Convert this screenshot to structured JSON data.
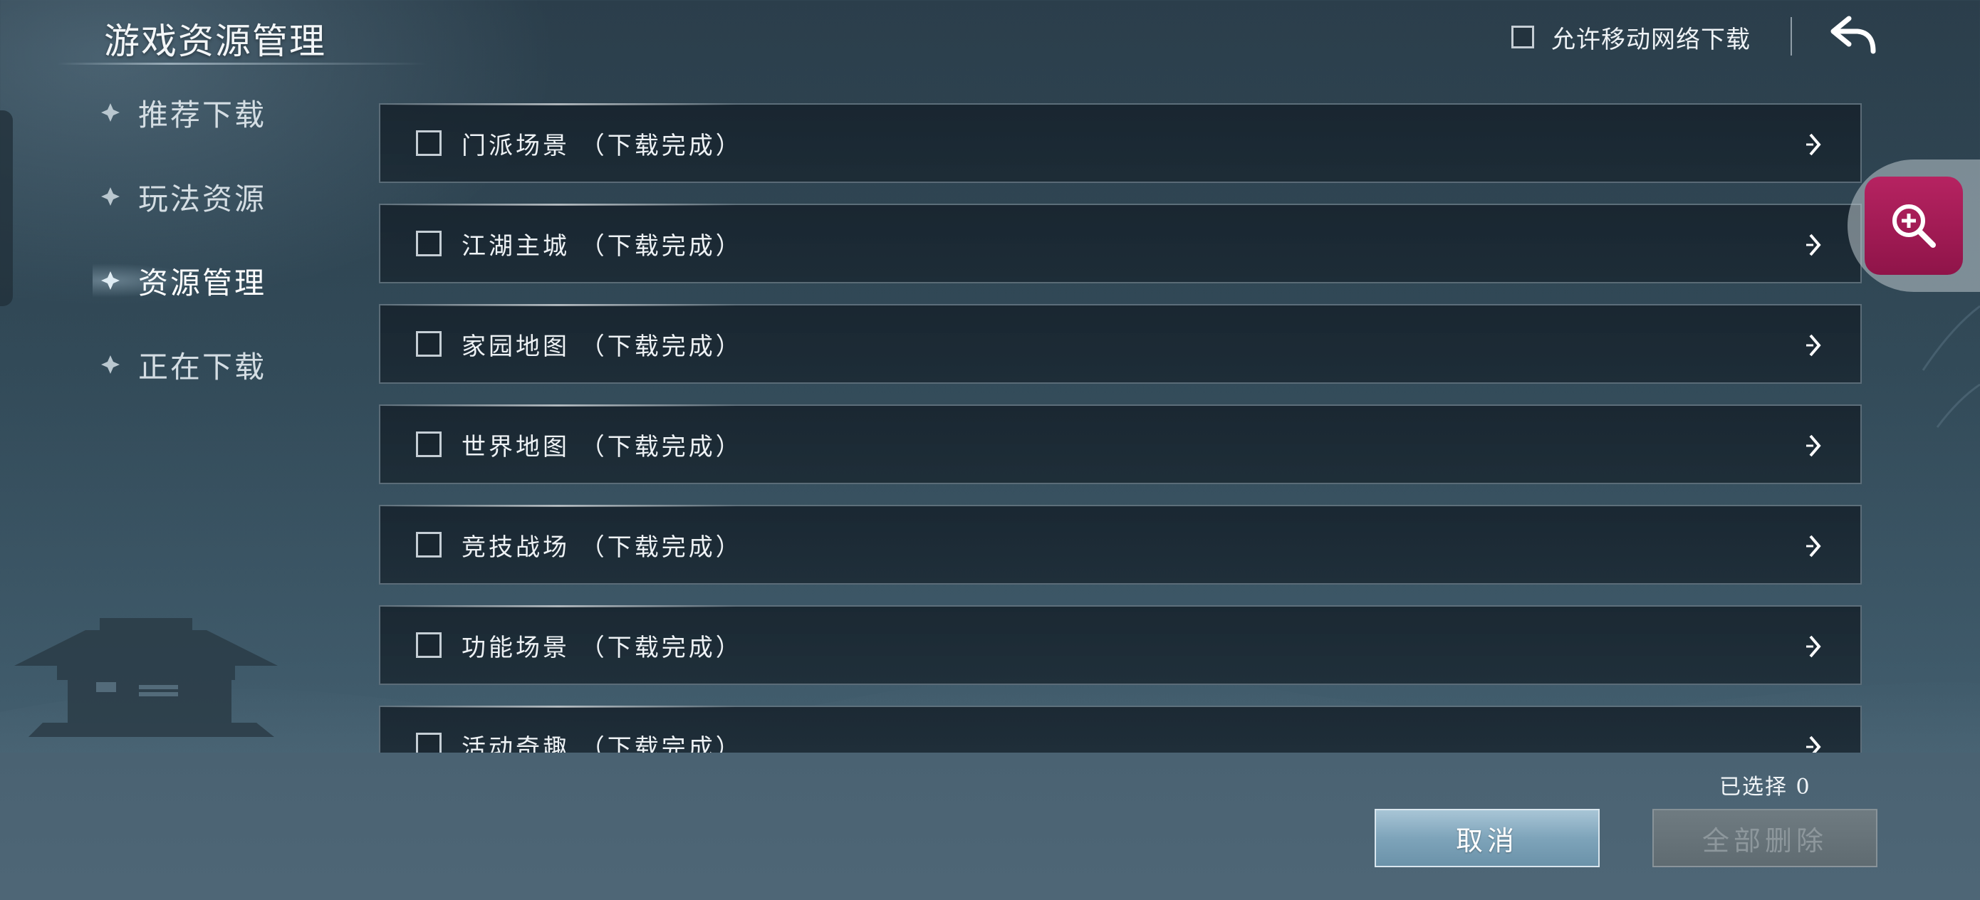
{
  "header": {
    "title": "游戏资源管理",
    "mobile_download_label": "允许移动网络下载",
    "mobile_download_checked": false
  },
  "sidebar": {
    "items": [
      {
        "label": "推荐下载"
      },
      {
        "label": "玩法资源"
      },
      {
        "label": "资源管理",
        "active": true
      },
      {
        "label": "正在下载"
      }
    ]
  },
  "resources": [
    {
      "label": "门派场景 （下载完成）",
      "checked": false
    },
    {
      "label": "江湖主城 （下载完成）",
      "checked": false
    },
    {
      "label": "家园地图 （下载完成）",
      "checked": false
    },
    {
      "label": "世界地图 （下载完成）",
      "checked": false
    },
    {
      "label": "竞技战场 （下载完成）",
      "checked": false
    },
    {
      "label": "功能场景 （下载完成）",
      "checked": false
    },
    {
      "label": "活动奇趣 （下载完成）",
      "checked": false
    }
  ],
  "footer": {
    "selected_label": "已选择 0",
    "cancel_label": "取消",
    "delete_all_label": "全部删除"
  },
  "icons": {
    "back": "back-arrow-icon",
    "zoom": "zoom-in-icon",
    "nav_bullet": "diamond-bullet-icon",
    "row_arrow": "chevron-right-icon"
  },
  "colors": {
    "zoom_button": "#a81a57",
    "cancel_button": "#8fb2c6"
  }
}
